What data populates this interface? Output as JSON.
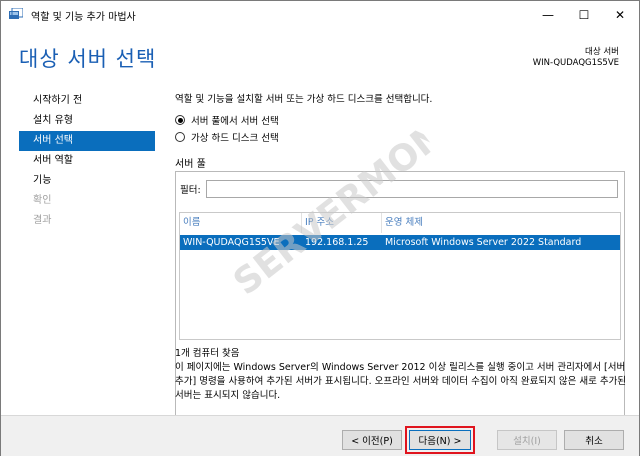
{
  "window": {
    "title": "역할 및 기능 추가 마법사",
    "minimize_glyph": "—",
    "maximize_glyph": "☐",
    "close_glyph": "✕"
  },
  "header": {
    "page_title": "대상 서버 선택",
    "destination_label": "대상 서버",
    "destination_value": "WIN-QUDAQG1S5VE"
  },
  "nav": {
    "items": [
      {
        "label": "시작하기 전",
        "state": "normal"
      },
      {
        "label": "설치 유형",
        "state": "normal"
      },
      {
        "label": "서버 선택",
        "state": "active"
      },
      {
        "label": "서버 역할",
        "state": "normal"
      },
      {
        "label": "기능",
        "state": "normal"
      },
      {
        "label": "확인",
        "state": "disabled"
      },
      {
        "label": "결과",
        "state": "disabled"
      }
    ]
  },
  "main": {
    "description": "역할 및 기능을 설치할 서버 또는 가상 하드 디스크를 선택합니다.",
    "options": [
      {
        "label": "서버 풀에서 서버 선택",
        "checked": true
      },
      {
        "label": "가상 하드 디스크 선택",
        "checked": false
      }
    ],
    "pool_label": "서버 풀",
    "filter_label": "필터:",
    "filter_value": "",
    "columns": [
      "이름",
      "IP 주소",
      "운영 체제"
    ],
    "rows": [
      {
        "name": "WIN-QUDAQG1S5VE",
        "ip": "192.168.1.25",
        "os": "Microsoft Windows Server 2022 Standard"
      }
    ],
    "count_text": "1개 컴퓨터 찾음",
    "info_text": "이 페이지에는 Windows Server의 Windows Server 2012 이상 릴리스를 실행 중이고 서버 관리자에서 [서버 추가] 명령을 사용하여 추가된 서버가 표시됩니다. 오프라인 서버와 데이터 수집이 아직 완료되지 않은 새로 추가된 서버는 표시되지 않습니다."
  },
  "watermark": {
    "text": "SERVERMON"
  },
  "footer": {
    "prev_label": "< 이전(P)",
    "next_label": "다음(N) >",
    "install_label": "설치(I)",
    "cancel_label": "취소"
  },
  "colors": {
    "accent": "#0a6ebd",
    "title_blue": "#1a5fb4",
    "highlight_red": "#e0141e"
  }
}
